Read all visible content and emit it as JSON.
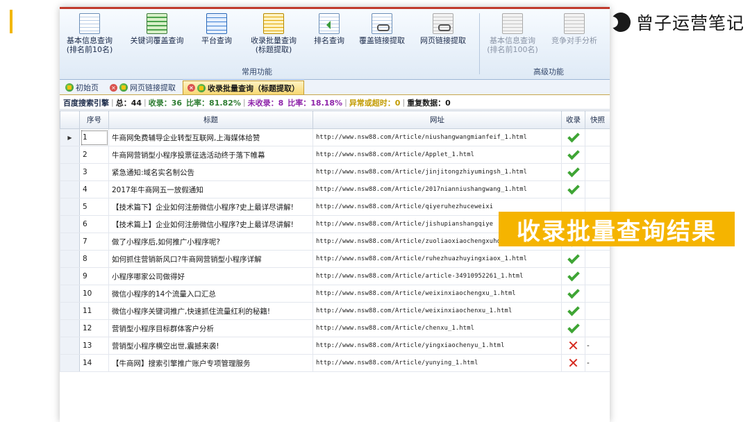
{
  "brand": {
    "text": "曾子运营笔记"
  },
  "ribbon": {
    "buttons": [
      {
        "label1": "基本信息查询",
        "label2": "(排名前10名)"
      },
      {
        "label1": "关键词覆盖查询",
        "label2": ""
      },
      {
        "label1": "平台查询",
        "label2": ""
      },
      {
        "label1": "收录批量查询",
        "label2": "(标题提取)"
      },
      {
        "label1": "排名查询",
        "label2": ""
      },
      {
        "label1": "覆盖链接提取",
        "label2": ""
      },
      {
        "label1": "网页链接提取",
        "label2": ""
      },
      {
        "label1": "基本信息查询",
        "label2": "(排名前100名)"
      },
      {
        "label1": "竞争对手分析",
        "label2": ""
      }
    ],
    "group_common": "常用功能",
    "group_advanced": "高级功能"
  },
  "tabs": [
    {
      "label": "初始页"
    },
    {
      "label": "网页链接提取"
    },
    {
      "label": "收录批量查询（标题提取）"
    }
  ],
  "stats": {
    "engine": "百度搜索引擎",
    "total": "总：44",
    "indexed": "收录：36",
    "rate": "比率：81.82%",
    "not_indexed": "未收录：8",
    "rate2": "比率：18.18%",
    "errors": "异常或超时：0",
    "duplicates": "重复数据：0"
  },
  "table": {
    "headers": {
      "seq": "序号",
      "title": "标题",
      "url": "网址",
      "indexed": "收录",
      "snapshot": "快照"
    },
    "rows": [
      {
        "seq": "1",
        "title": "牛商网免费辅导企业转型互联网,上海媒体给赞",
        "url": "http://www.nsw88.com/Article/niushangwangmianfeif_1.html",
        "status": "yes",
        "snap": ""
      },
      {
        "seq": "2",
        "title": "牛商网营销型小程序投票征选活动终于落下帷幕",
        "url": "http://www.nsw88.com/Article/Applet_1.html",
        "status": "yes",
        "snap": ""
      },
      {
        "seq": "3",
        "title": "紧急通知:域名实名制公告",
        "url": "http://www.nsw88.com/Article/jinjitongzhiyumingsh_1.html",
        "status": "yes",
        "snap": ""
      },
      {
        "seq": "4",
        "title": "2017年牛商网五一放假通知",
        "url": "http://www.nsw88.com/Article/2017nianniushangwang_1.html",
        "status": "yes",
        "snap": ""
      },
      {
        "seq": "5",
        "title": "【技术篇下】企业如何注册微信小程序?史上最详尽讲解!",
        "url": "http://www.nsw88.com/Article/qiyeruhezhuceweixi",
        "status": "",
        "snap": ""
      },
      {
        "seq": "6",
        "title": "【技术篇上】企业如何注册微信小程序?史上最详尽讲解!",
        "url": "http://www.nsw88.com/Article/jishupianshangqiye",
        "status": "",
        "snap": ""
      },
      {
        "seq": "7",
        "title": "做了小程序后,如何推广小程序呢?",
        "url": "http://www.nsw88.com/Article/zuoliaoxiaochengxuho_1.html",
        "status": "yes",
        "snap": ""
      },
      {
        "seq": "8",
        "title": "如何抓住营销新风口?牛商网营销型小程序详解",
        "url": "http://www.nsw88.com/Article/ruhezhuazhuyingxiaox_1.html",
        "status": "yes",
        "snap": ""
      },
      {
        "seq": "9",
        "title": "小程序哪家公司做得好",
        "url": "http://www.nsw88.com/Article/article-34910952261_1.html",
        "status": "yes",
        "snap": ""
      },
      {
        "seq": "10",
        "title": "微信小程序的14个流量入口汇总",
        "url": "http://www.nsw88.com/Article/weixinxiaochengxu_1.html",
        "status": "yes",
        "snap": ""
      },
      {
        "seq": "11",
        "title": "微信小程序关键词推广,快速抓住流量红利的秘籍!",
        "url": "http://www.nsw88.com/Article/weixinxiaochenxu_1.html",
        "status": "yes",
        "snap": ""
      },
      {
        "seq": "12",
        "title": "营销型小程序目标群体客户分析",
        "url": "http://www.nsw88.com/Article/chenxu_1.html",
        "status": "yes",
        "snap": ""
      },
      {
        "seq": "13",
        "title": "营销型小程序横空出世,震撼来袭!",
        "url": "http://www.nsw88.com/Article/yingxiaochenyu_1.html",
        "status": "no",
        "snap": "-"
      },
      {
        "seq": "14",
        "title": "【牛商网】搜索引擎推广账户专项管理服务",
        "url": "http://www.nsw88.com/Article/yunying_1.html",
        "status": "no",
        "snap": "-"
      }
    ]
  },
  "banner": {
    "text": "收录批量查询结果"
  },
  "colors": {
    "accent": "#f5b400",
    "check": "#3fa535",
    "cross": "#d62b20"
  }
}
